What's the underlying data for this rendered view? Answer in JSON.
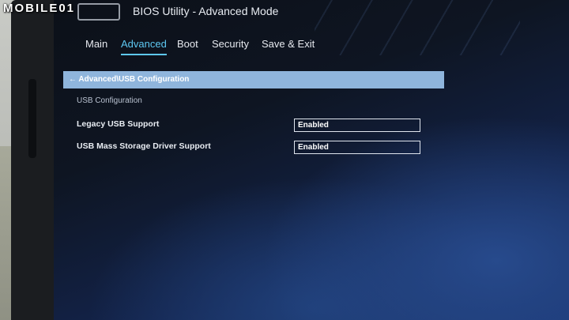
{
  "watermark": "MOBILE01",
  "window": {
    "title": "BIOS Utility - Advanced Mode"
  },
  "tabs": [
    {
      "label": "Main"
    },
    {
      "label": "Advanced",
      "active": true
    },
    {
      "label": "Boot"
    },
    {
      "label": "Security"
    },
    {
      "label": "Save & Exit"
    }
  ],
  "breadcrumb": "← Advanced\\USB Configuration",
  "section": {
    "title": "USB Configuration"
  },
  "settings": [
    {
      "label": "Legacy USB Support",
      "value": "Enabled"
    },
    {
      "label": "USB Mass Storage Driver Support",
      "value": "Enabled"
    }
  ],
  "colors": {
    "accent": "#5ec8f2",
    "breadcrumb_bg": "#8fb5dc",
    "screen_bg": "#0e1522"
  }
}
